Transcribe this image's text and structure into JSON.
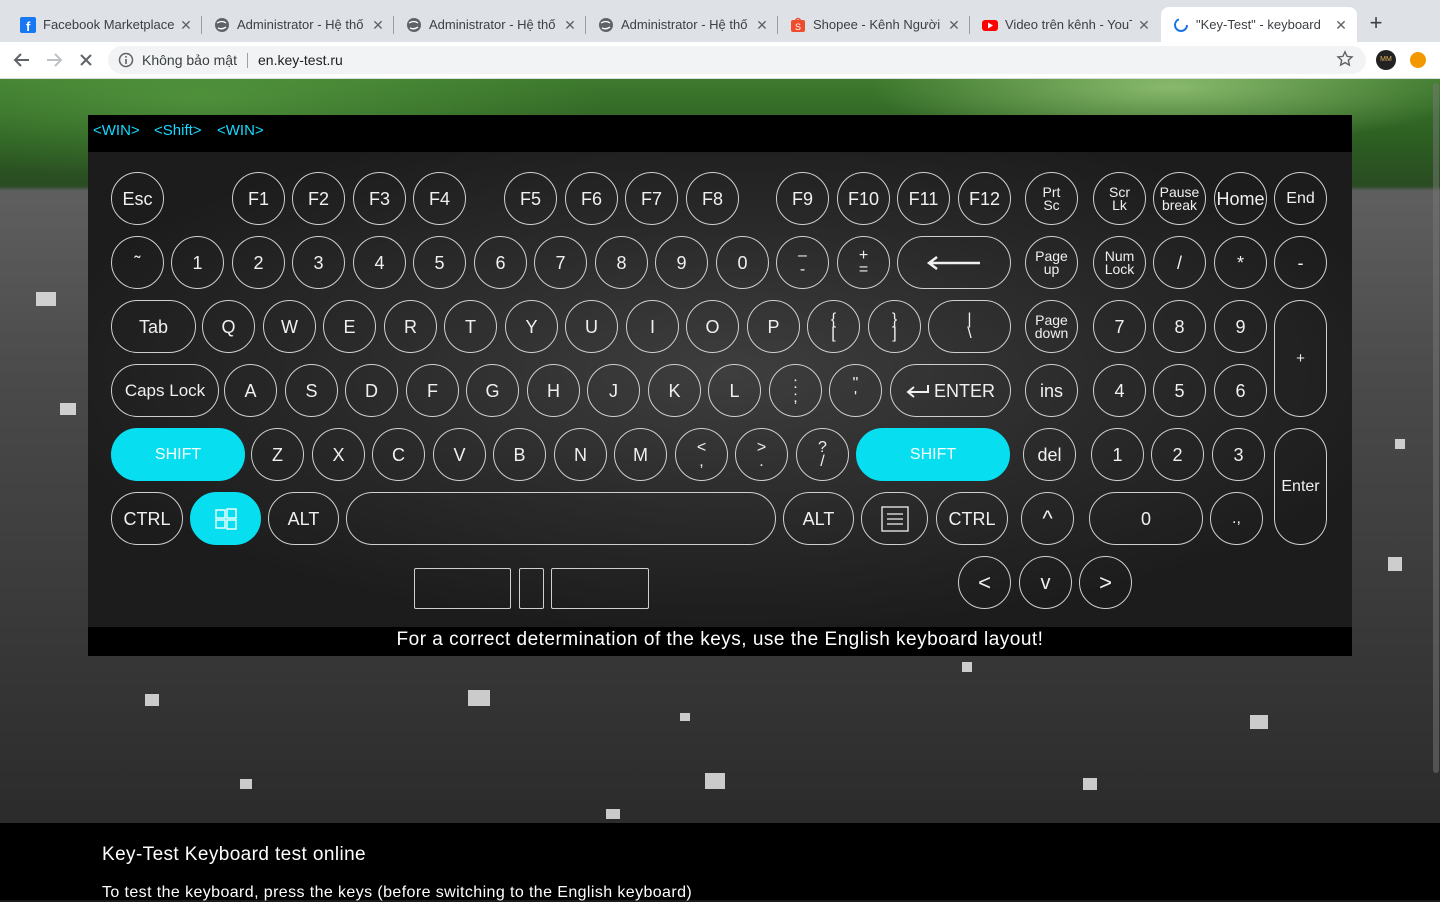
{
  "browser": {
    "tabs": [
      {
        "title": "Facebook Marketplace",
        "icon": "facebook-icon"
      },
      {
        "title": "Administrator - Hệ thố",
        "icon": "globe-icon"
      },
      {
        "title": "Administrator - Hệ thố",
        "icon": "globe-icon"
      },
      {
        "title": "Administrator - Hệ thố",
        "icon": "globe-icon"
      },
      {
        "title": "Shopee - Kênh Người ",
        "icon": "shopee-icon"
      },
      {
        "title": "Video trên kênh - YouT",
        "icon": "youtube-icon"
      },
      {
        "title": "\"Key-Test\" - keyboard",
        "icon": "loading-spinner-icon"
      }
    ],
    "active_tab": 6,
    "security_label": "Không bảo mật",
    "url": "en.key-test.ru",
    "profile_initials": "MM"
  },
  "keyboard": {
    "detected_keys": [
      "<WIN>",
      "<Shift>",
      "<WIN>"
    ],
    "highlight_color": "#07def0",
    "rows": {
      "function": [
        "Esc",
        "F1",
        "F2",
        "F3",
        "F4",
        "F5",
        "F6",
        "F7",
        "F8",
        "F9",
        "F10",
        "F11",
        "F12"
      ],
      "number": [
        "˜",
        "1",
        "2",
        "3",
        "4",
        "5",
        "6",
        "7",
        "8",
        "9",
        "0"
      ],
      "qwerty": [
        "Tab",
        "Q",
        "W",
        "E",
        "R",
        "T",
        "Y",
        "U",
        "I",
        "O",
        "P"
      ],
      "home": [
        "Caps Lock",
        "A",
        "S",
        "D",
        "F",
        "G",
        "H",
        "J",
        "K",
        "L"
      ],
      "shift": [
        "SHIFT",
        "Z",
        "X",
        "C",
        "V",
        "B",
        "N",
        "M",
        "SHIFT"
      ],
      "bottom": [
        "CTRL",
        "ALT",
        "ALT",
        "CTRL"
      ],
      "numpad": [
        "Num Lock",
        "/",
        "*",
        "-",
        "7",
        "8",
        "9",
        "+",
        "4",
        "5",
        "6",
        "1",
        "2",
        "3",
        "Enter",
        "0",
        ".,"
      ],
      "nav": [
        "Prt Sc",
        "Scr Lk",
        "Pause break",
        "Home",
        "End",
        "Page up",
        "Page down",
        "ins",
        "del"
      ],
      "arrows": [
        "^",
        "<",
        "v",
        ">"
      ],
      "enter": "ENTER"
    },
    "pressed": [
      "SHIFT",
      "WIN"
    ]
  },
  "notice": "For a correct determination of the keys, use the English keyboard layout!",
  "footer": {
    "heading": "Key-Test Keyboard test online",
    "text": "To test the keyboard, press the keys (before switching to the English keyboard)"
  }
}
